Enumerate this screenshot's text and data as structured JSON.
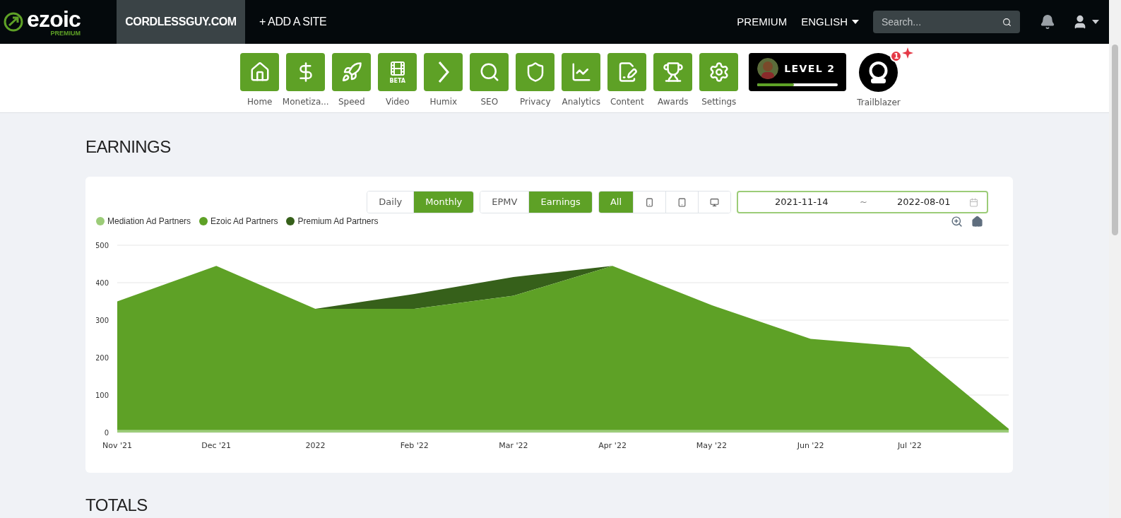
{
  "topbar": {
    "logo": "ezoic",
    "logo_sub": "PREMIUM",
    "sites": [
      {
        "label": "CORDLESSGUY.COM",
        "selected": true
      },
      {
        "label": "+ ADD A SITE",
        "selected": false
      }
    ],
    "links": [
      "PREMIUM"
    ],
    "language": "ENGLISH",
    "search": {
      "placeholder": "Search..."
    }
  },
  "nav": {
    "items": [
      {
        "label": "Home"
      },
      {
        "label": "Monetiza..."
      },
      {
        "label": "Speed"
      },
      {
        "label": "Video",
        "badge": "BETA"
      },
      {
        "label": "Humix"
      },
      {
        "label": "SEO"
      },
      {
        "label": "Privacy"
      },
      {
        "label": "Analytics"
      },
      {
        "label": "Content"
      },
      {
        "label": "Awards"
      },
      {
        "label": "Settings"
      }
    ],
    "level_card": {
      "label": "LEVEL 2",
      "level": 0.45
    },
    "trailblazer": {
      "label": "Trailblazer",
      "count": "1"
    }
  },
  "earnings": {
    "title": "EARNINGS",
    "period": [
      {
        "label": "Daily",
        "selected": false
      },
      {
        "label": "Monthly",
        "selected": true
      }
    ],
    "metric": [
      {
        "label": "EPMV",
        "selected": false
      },
      {
        "label": "Earnings",
        "selected": true
      }
    ],
    "device": [
      {
        "kind": "text",
        "label": "All",
        "selected": true
      },
      {
        "kind": "phone",
        "selected": false
      },
      {
        "kind": "tablet",
        "selected": false
      },
      {
        "kind": "desktop",
        "selected": false
      }
    ],
    "date_range": {
      "start": "2021-11-14",
      "separator": "~",
      "end": "2022-08-01"
    },
    "chart_data": {
      "type": "area",
      "stacked": true,
      "grid": true,
      "categories": [
        "Nov '21",
        "Dec '21",
        "2022",
        "Feb '22",
        "Mar '22",
        "Apr '22",
        "May '22",
        "Jun '22",
        "Jul '22",
        null
      ],
      "yticks": [
        0,
        100,
        200,
        300,
        400,
        500
      ],
      "ylim": [
        0,
        500
      ],
      "series": [
        {
          "name": "Mediation Ad Partners",
          "color": "#9ccc78",
          "values": [
            6,
            6,
            6,
            6,
            6,
            6,
            6,
            6,
            6,
            6
          ]
        },
        {
          "name": "Ezoic Ad Partners",
          "color": "#5ea126",
          "values": [
            344,
            439,
            324,
            324,
            359,
            439,
            334,
            244,
            222,
            4
          ]
        },
        {
          "name": "Premium Ad Partners",
          "color": "#36601a",
          "values": [
            0,
            0,
            0,
            40,
            50,
            0,
            0,
            0,
            0,
            0
          ]
        }
      ]
    }
  },
  "totals": {
    "title": "TOTALS"
  }
}
